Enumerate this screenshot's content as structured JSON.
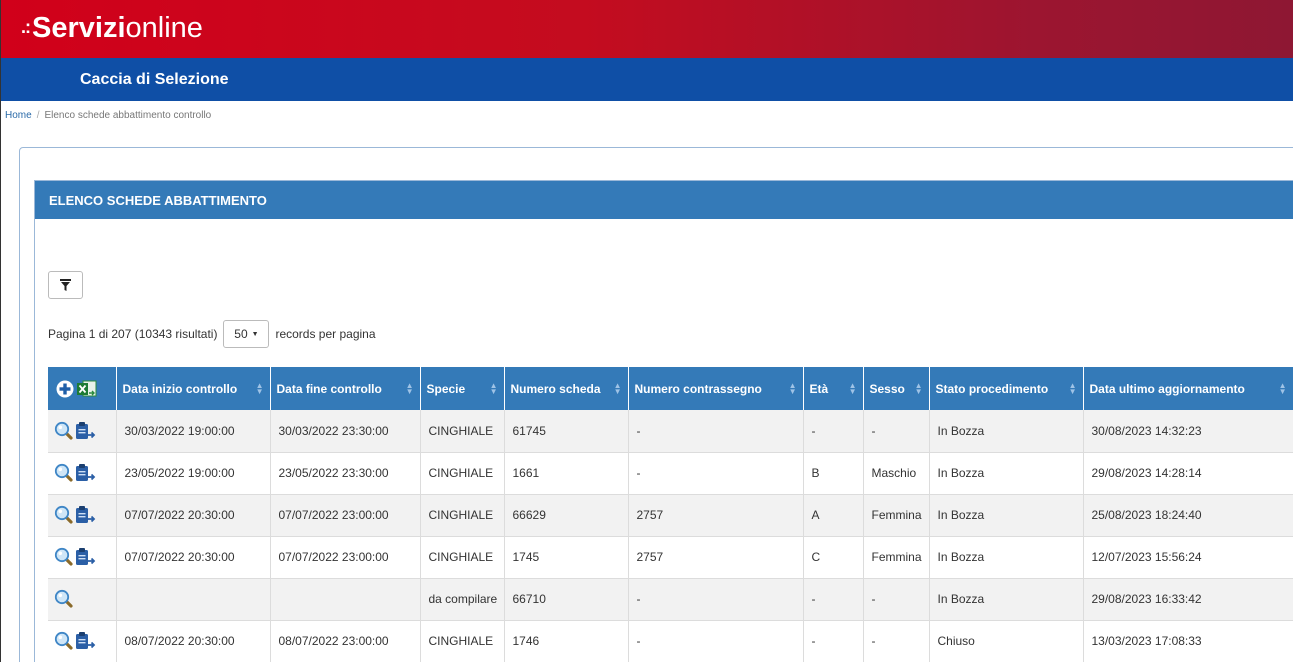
{
  "brand": {
    "dots": ".:",
    "name_bold": "Servizi",
    "name_light": "online"
  },
  "app": {
    "title": "Caccia di Selezione"
  },
  "breadcrumb": {
    "home": "Home",
    "separator": "/",
    "current": "Elenco schede abbattimento controllo"
  },
  "panel": {
    "title": "ELENCO SCHEDE ABBATTIMENTO"
  },
  "pager": {
    "info": "Pagina 1 di 207 (10343 risultati)",
    "page_size": "50",
    "suffix": "records per pagina"
  },
  "table": {
    "columns": [
      "Data inizio controllo",
      "Data fine controllo",
      "Specie",
      "Numero scheda",
      "Numero contrassegno",
      "Età",
      "Sesso",
      "Stato procedimento",
      "Data ultimo aggiornamento"
    ],
    "rows": [
      {
        "edit": true,
        "cells": [
          "30/03/2022 19:00:00",
          "30/03/2022 23:30:00",
          "CINGHIALE",
          "61745",
          "-",
          "-",
          "-",
          "In Bozza",
          "30/08/2023 14:32:23"
        ]
      },
      {
        "edit": true,
        "cells": [
          "23/05/2022 19:00:00",
          "23/05/2022 23:30:00",
          "CINGHIALE",
          "1661",
          "-",
          "B",
          "Maschio",
          "In Bozza",
          "29/08/2023 14:28:14"
        ]
      },
      {
        "edit": true,
        "cells": [
          "07/07/2022 20:30:00",
          "07/07/2022 23:00:00",
          "CINGHIALE",
          "66629",
          "2757",
          "A",
          "Femmina",
          "In Bozza",
          "25/08/2023 18:24:40"
        ]
      },
      {
        "edit": true,
        "cells": [
          "07/07/2022 20:30:00",
          "07/07/2022 23:00:00",
          "CINGHIALE",
          "1745",
          "2757",
          "C",
          "Femmina",
          "In Bozza",
          "12/07/2023 15:56:24"
        ]
      },
      {
        "edit": false,
        "cells": [
          "",
          "",
          "da compilare",
          "66710",
          "-",
          "-",
          "-",
          "In Bozza",
          "29/08/2023 16:33:42"
        ]
      },
      {
        "edit": true,
        "cells": [
          "08/07/2022 20:30:00",
          "08/07/2022 23:00:00",
          "CINGHIALE",
          "1746",
          "-",
          "-",
          "-",
          "Chiuso",
          "13/03/2023 17:08:33"
        ]
      }
    ]
  },
  "colors": {
    "brand_red": "#d1001a",
    "app_blue": "#0f4fa6",
    "panel_blue": "#347ab8"
  },
  "icons": [
    "filter-icon",
    "add-icon",
    "excel-export-icon",
    "view-icon",
    "edit-clipboard-icon",
    "sort-icon"
  ]
}
